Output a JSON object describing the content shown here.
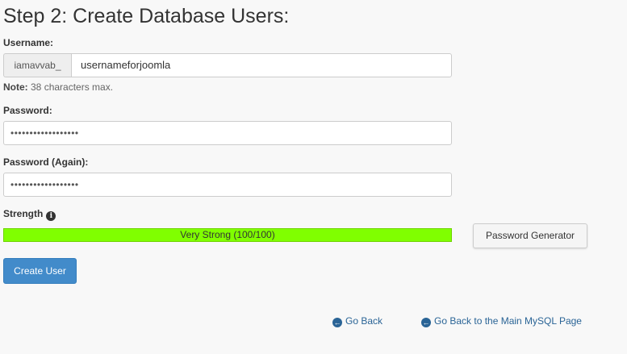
{
  "page": {
    "title": "Step 2: Create Database Users:"
  },
  "form": {
    "username_label": "Username:",
    "username_prefix": "iamavvab_",
    "username_value": "usernameforjoomla",
    "note_bold": "Note:",
    "note_text": " 38 characters max.",
    "password_label": "Password:",
    "password_value": "••••••••••••••••••",
    "password_again_label": "Password (Again):",
    "password_again_value": "••••••••••••••••••",
    "strength_label": "Strength",
    "strength_info_icon": "i",
    "strength_text": "Very Strong (100/100)",
    "strength_percent": 100,
    "strength_color": "#80ff00",
    "password_generator_label": "Password Generator",
    "create_user_label": "Create User"
  },
  "links": {
    "go_back": "Go Back",
    "go_back_main": "Go Back to the Main MySQL Page",
    "arrow_icon": "←"
  },
  "colors": {
    "primary_button": "#428bca",
    "link": "#2a6496"
  }
}
